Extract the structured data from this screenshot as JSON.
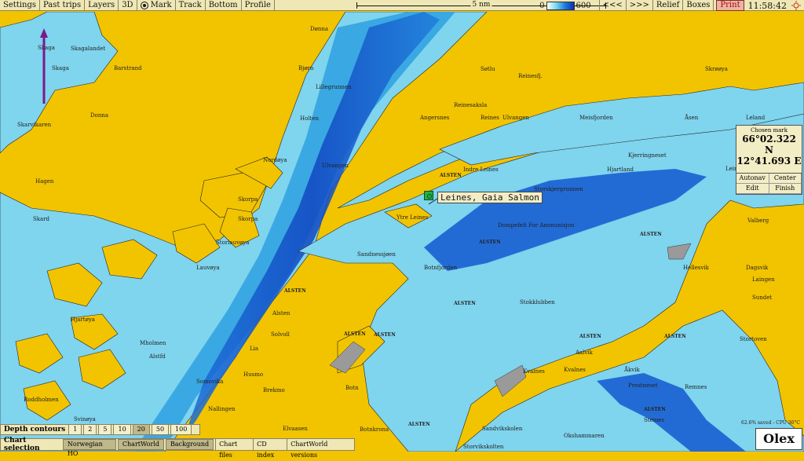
{
  "toolbar": {
    "buttons": [
      "Settings",
      "Past trips",
      "Layers",
      "3D",
      "Mark",
      "Track",
      "Bottom",
      "Profile"
    ],
    "scale_label": "5 nm",
    "legend_min": "0",
    "legend_max": "600",
    "back_label": "<<<",
    "forward_label": ">>>",
    "relief_label": "Relief",
    "boxes_label": "Boxes",
    "print_label": "Print",
    "time": "11:58:42"
  },
  "mark": {
    "label": "Leines, Gaia Salmon"
  },
  "chosen_mark": {
    "title": "Chosen mark",
    "lat": "66°02.322 N",
    "lon": "12°41.693 E",
    "buttons": [
      "Autonav",
      "Center",
      "Edit",
      "Finish"
    ]
  },
  "depth_contours": {
    "label": "Depth contours",
    "options": [
      "1",
      "2",
      "5",
      "10",
      "20",
      "50",
      "100"
    ],
    "selected": "20"
  },
  "chart_selection": {
    "label": "Chart selection",
    "options": [
      "Norwegian HO",
      "ChartWorld",
      "Background"
    ],
    "extras": [
      "Chart files",
      "CD index",
      "ChartWorld versions"
    ]
  },
  "status": "62.6% saved - CPU 36°C",
  "logo": "Olex",
  "places": [
    {
      "t": "Skagalandet"
    },
    {
      "t": "Skaga"
    },
    {
      "t": "Barstrand"
    },
    {
      "t": "Donna"
    },
    {
      "t": "Hagen"
    },
    {
      "t": "Skard"
    },
    {
      "t": "Skaga"
    },
    {
      "t": "Skarvikaren"
    },
    {
      "t": "Lillegrunnen"
    },
    {
      "t": "Bjørn"
    },
    {
      "t": "Holten"
    },
    {
      "t": "Dønna"
    },
    {
      "t": "Ulvangen"
    },
    {
      "t": "Skorpa"
    },
    {
      "t": "Skorpa"
    },
    {
      "t": "Storlauvøya"
    },
    {
      "t": "Lauvøya"
    },
    {
      "t": "Hjartøya"
    },
    {
      "t": "Mholmen"
    },
    {
      "t": "Alstfd"
    },
    {
      "t": "Somovika"
    },
    {
      "t": "Nallingen"
    },
    {
      "t": "Husmo"
    },
    {
      "t": "Brekmo"
    },
    {
      "t": "Lia"
    },
    {
      "t": "Solvoll"
    },
    {
      "t": "Alsten"
    },
    {
      "t": "Elvaasen"
    },
    {
      "t": "Botn"
    },
    {
      "t": "Botnkrona"
    },
    {
      "t": "Sandnessjøen"
    },
    {
      "t": "Botnfjorden"
    },
    {
      "t": "Ytre Leines"
    },
    {
      "t": "Angersnes"
    },
    {
      "t": "Reines"
    },
    {
      "t": "Ulvangen"
    },
    {
      "t": "Reinesaksla"
    },
    {
      "t": "Søtlu"
    },
    {
      "t": "Reinesfj."
    },
    {
      "t": "Indre Leines"
    },
    {
      "t": "Storskjergrunnen"
    },
    {
      "t": "Dompefelt For Ammunisjon"
    },
    {
      "t": "Meisfjorden"
    },
    {
      "t": "Hjartland"
    },
    {
      "t": "Kjerringneset"
    },
    {
      "t": "Åsen"
    },
    {
      "t": "Leland"
    },
    {
      "t": "Skrøøya"
    },
    {
      "t": "Leines"
    },
    {
      "t": "Valberg"
    },
    {
      "t": "Hellesvik"
    },
    {
      "t": "Dagsvik"
    },
    {
      "t": "Laingen"
    },
    {
      "t": "Sundet"
    },
    {
      "t": "Stortoven"
    },
    {
      "t": "Stokklubben"
    },
    {
      "t": "Aalvik"
    },
    {
      "t": "Kvalnes"
    },
    {
      "t": "Kvalnes"
    },
    {
      "t": "Åkvik"
    },
    {
      "t": "Prestneset"
    },
    {
      "t": "Remnes"
    },
    {
      "t": "Sandvikskolen"
    },
    {
      "t": "Okshammaren"
    },
    {
      "t": "Storvikskolten"
    },
    {
      "t": "Stemes"
    },
    {
      "t": "Svinøya"
    },
    {
      "t": "Roddholmen"
    },
    {
      "t": "Nordøya"
    }
  ],
  "tags": [
    "ALSTEN",
    "ALSTEN",
    "ALSTEN",
    "ALSTEN",
    "ALSTEN",
    "ALSTEN",
    "ALSTEN",
    "ALSTEN",
    "ALSTEN",
    "ALSTEN",
    "ALSTEN"
  ]
}
